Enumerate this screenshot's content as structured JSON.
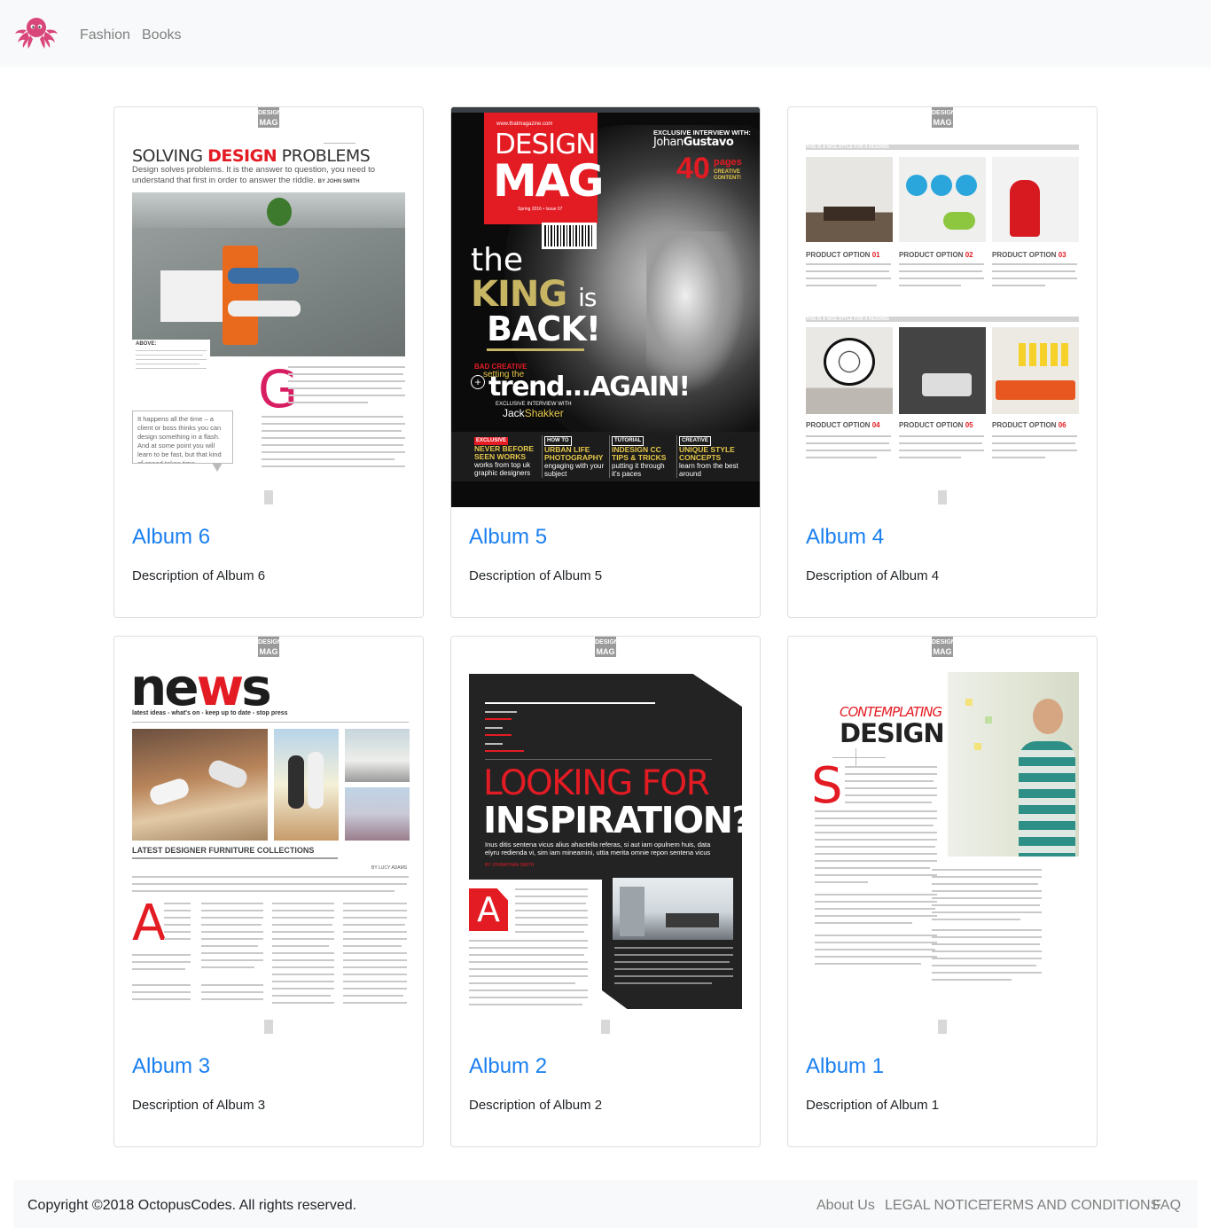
{
  "navbar": {
    "logo_icon": "octopus-logo-icon",
    "links": [
      {
        "label": "Fashion"
      },
      {
        "label": "Books"
      }
    ]
  },
  "albums": [
    {
      "title": "Album 6",
      "description": "Description of Album 6",
      "cover": {
        "mag_tag": [
          "DESIGN",
          "MAG"
        ],
        "headline_1": "SOLVING",
        "headline_2": "DESIGN",
        "headline_3": "PROBLEMS",
        "intro": "Design solves problems. It is the answer to question, you need to understand that first in order to answer the riddle.",
        "byline": "BY JOHN SMITH",
        "caption_label": "ABOVE:",
        "drop_cap": "G",
        "quote": "It happens all the time – a client or boss thinks you can design something in a flash. And at some point you will learn to be fast, but that kind of speed takes time."
      }
    },
    {
      "title": "Album 5",
      "description": "Description of Album 5",
      "cover": {
        "url": "www.thatmagazine.com",
        "mast_1": "DESIGN",
        "mast_2": "MAG",
        "issue": "Spring 2016 • Issue 07",
        "interview_label": "EXCLUSIVE INTERVIEW WITH:",
        "interview_name_1": "Johan",
        "interview_name_2": "Gustavo",
        "pages_num": "40",
        "pages_label": "pages",
        "pages_sub": "CREATIVE CONTENT!",
        "king_1": "the",
        "king_2": "KING",
        "king_3": "is",
        "king_4": "BACK!",
        "trend_1": "BAD CREATIVE",
        "trend_2": "setting the",
        "trend_3": "trend...AGAIN!",
        "trend_4": "EXCLUSIVE INTERVIEW WITH",
        "trend_5": "Jack",
        "trend_6": "Shakker",
        "bottom": [
          {
            "tag": "EXCLUSIVE",
            "head": "NEVER BEFORE SEEN WORKS",
            "sub": "works from top uk graphic designers"
          },
          {
            "tag": "HOW TO",
            "head": "URBAN LIFE PHOTOGRAPHY",
            "sub": "engaging with your subject"
          },
          {
            "tag": "TUTORIAL",
            "head": "INDESIGN CC TIPS & TRICKS",
            "sub": "putting it through it's paces"
          },
          {
            "tag": "CREATIVE",
            "head": "UNIQUE STYLE CONCEPTS",
            "sub": "learn from the best around"
          }
        ]
      }
    },
    {
      "title": "Album 4",
      "description": "Description of Album 4",
      "cover": {
        "mag_tag": [
          "DESIGN",
          "MAG"
        ],
        "heading_bar": "THIS IS A NICE STYLE FOR A HEADING",
        "product_label": "PRODUCT OPTION",
        "products": [
          "01",
          "02",
          "03",
          "04",
          "05",
          "06"
        ]
      }
    },
    {
      "title": "Album 3",
      "description": "Description of Album 3",
      "cover": {
        "mag_tag": [
          "DESIGN",
          "MAG"
        ],
        "news_1": "ne",
        "news_2": "w",
        "news_3": "s",
        "tagline": "latest ideas - what's on - keep up to date - stop press",
        "section": "LATEST DESIGNER FURNITURE COLLECTIONS",
        "byline": "BY LUCY ADAMS",
        "drop_cap": "A"
      }
    },
    {
      "title": "Album 2",
      "description": "Description of Album 2",
      "cover": {
        "mag_tag": [
          "DESIGN",
          "MAG"
        ],
        "headline_1": "LOOKING FOR",
        "headline_2": "INSPIRATION?",
        "intro": "Inus ditis sentena vicus alius ahactella referas, si aut iam opulnem huis, data elyru redienda vi, sim iam mineamini, uttia merita omnie repon sentena vicus alius",
        "byline": "BY JOHNATHAN SMITH",
        "drop_cap": "A"
      }
    },
    {
      "title": "Album 1",
      "description": "Description of Album 1",
      "cover": {
        "mag_tag": [
          "DESIGN",
          "MAG"
        ],
        "headline_1": "CONTEMPLATING",
        "headline_2": "DESIGN",
        "drop_cap": "S"
      }
    }
  ],
  "footer": {
    "copyright": "Copyright ©2018 OctopusCodes. All rights reserved.",
    "links": [
      {
        "label": "About Us"
      },
      {
        "label": "LEGAL NOTICE"
      },
      {
        "label": "TERMS AND CONDITIONS"
      },
      {
        "label": "FAQ"
      }
    ]
  },
  "colors": {
    "link_blue": "#1a7ff0",
    "mag_red": "#e31b23",
    "mag_gold": "#c8b564",
    "navbar_bg": "#f8f9fa"
  }
}
